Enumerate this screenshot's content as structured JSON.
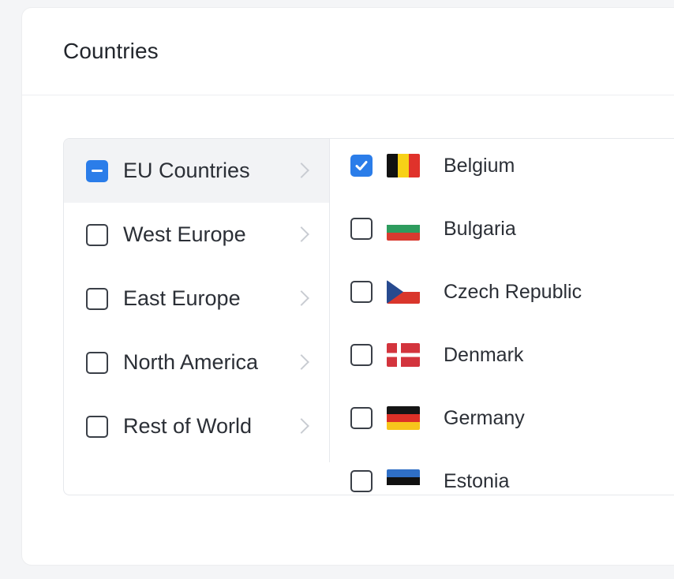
{
  "header": {
    "title": "Countries"
  },
  "regions": [
    {
      "label": "EU Countries",
      "state": "indeterminate"
    },
    {
      "label": "West Europe",
      "state": "unchecked"
    },
    {
      "label": "East Europe",
      "state": "unchecked"
    },
    {
      "label": "North America",
      "state": "unchecked"
    },
    {
      "label": "Rest of World",
      "state": "unchecked"
    }
  ],
  "countries": [
    {
      "label": "Belgium",
      "checked": true,
      "flag_icon": "belgium-flag-icon"
    },
    {
      "label": "Bulgaria",
      "checked": false,
      "flag_icon": "bulgaria-flag-icon"
    },
    {
      "label": "Czech Republic",
      "checked": false,
      "flag_icon": "czech-flag-icon"
    },
    {
      "label": "Denmark",
      "checked": false,
      "flag_icon": "denmark-flag-icon"
    },
    {
      "label": "Germany",
      "checked": false,
      "flag_icon": "germany-flag-icon"
    },
    {
      "label": "Estonia",
      "checked": false,
      "flag_icon": "estonia-flag-icon"
    }
  ],
  "colors": {
    "accent": "#2b7de9",
    "active_row": "#f2f3f5"
  }
}
